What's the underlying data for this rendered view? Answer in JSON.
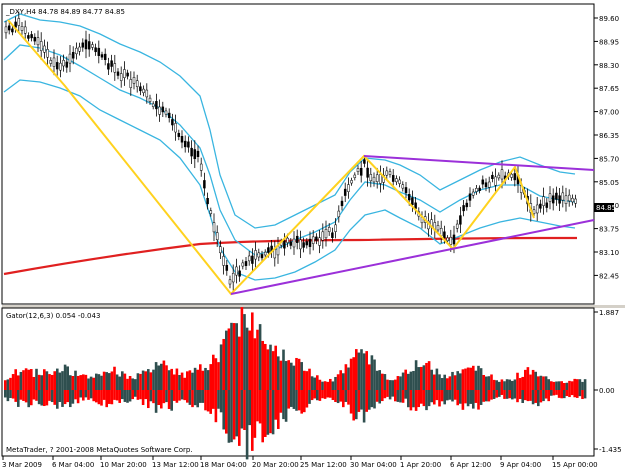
{
  "main_chart": {
    "header": "_DXY,H4  84.78 84.89 84.77 84.85",
    "price_badge": "84.85",
    "y_ticks": [
      "89.60",
      "88.95",
      "88.30",
      "87.65",
      "87.00",
      "86.35",
      "85.70",
      "85.05",
      "84.40",
      "83.75",
      "83.10",
      "82.45"
    ]
  },
  "gator": {
    "header": "Gator(12,6,3) 0.054 -0.043",
    "y_ticks": [
      "1.887",
      "0.00",
      "-1.435"
    ]
  },
  "x_axis": {
    "labels": [
      "3 Mar 2009",
      "6 Mar 04:00",
      "10 Mar 20:00",
      "13 Mar 12:00",
      "18 Mar 04:00",
      "20 Mar 20:00",
      "25 Mar 12:00",
      "30 Mar 04:00",
      "1 Apr 20:00",
      "6 Apr 12:00",
      "9 Apr 04:00",
      "15 Apr 00:00"
    ]
  },
  "footer": {
    "copyright": "MetaTrader, ? 2001-2008 MetaQuotes Software Corp."
  },
  "colors": {
    "bollinger": "#39b5e0",
    "zigzag": "#ffd21f",
    "trendline": "#9b30d9",
    "moving_average": "#e02020",
    "gator_up": "#ff0000",
    "gator_down": "#2f4f4f"
  }
}
